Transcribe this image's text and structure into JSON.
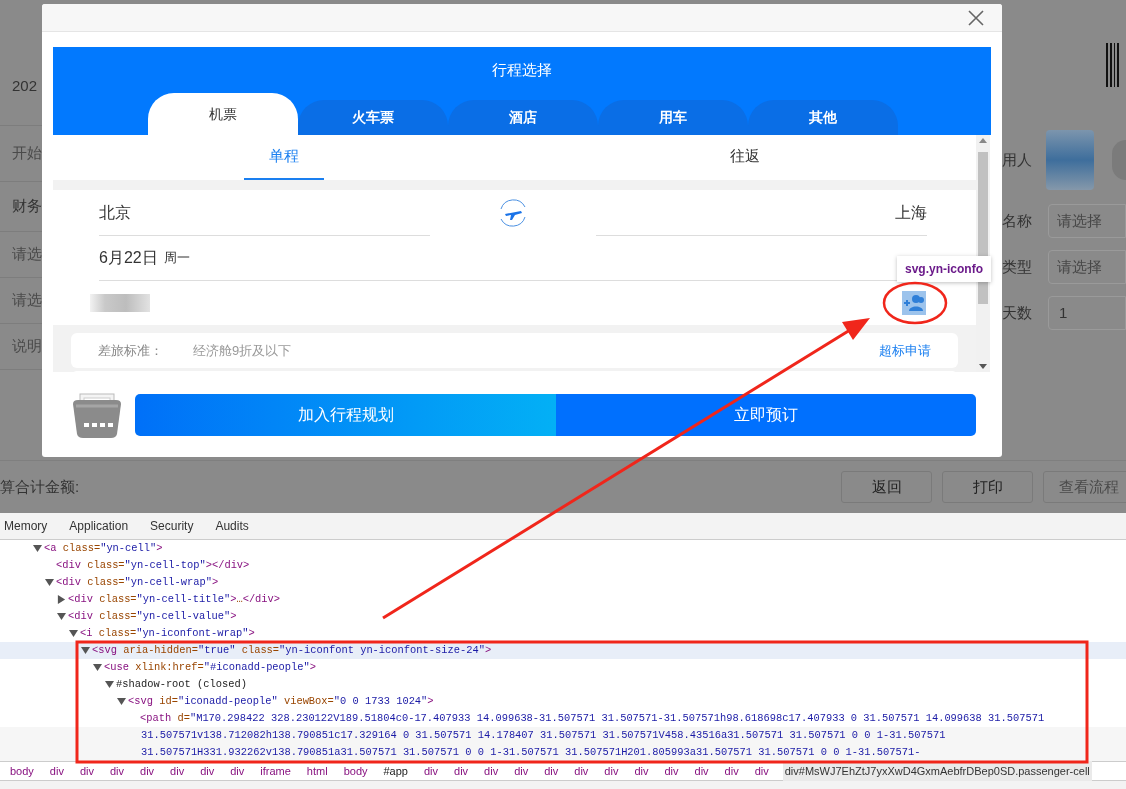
{
  "background_page": {
    "left_items": [
      {
        "kind": "label",
        "text": "202"
      },
      {
        "kind": "placeholder",
        "text": "开始"
      },
      {
        "kind": "label",
        "text": "财务"
      },
      {
        "kind": "placeholder",
        "text": "请选"
      },
      {
        "kind": "placeholder",
        "text": "请选"
      },
      {
        "kind": "placeholder",
        "text": "说明"
      }
    ],
    "right_fields": [
      {
        "kind": "avatar",
        "label": "用人"
      },
      {
        "kind": "select",
        "label": "名称",
        "placeholder": "请选择"
      },
      {
        "kind": "select",
        "label": "类型",
        "placeholder": "请选择"
      },
      {
        "kind": "text",
        "label": "天数",
        "value": "1"
      }
    ],
    "total_label": "算合计金额:",
    "buttons": [
      {
        "label": "返回",
        "disabled": false
      },
      {
        "label": "打印",
        "disabled": false
      },
      {
        "label": "查看流程",
        "disabled": true
      }
    ]
  },
  "dialog": {
    "title": "行程选择",
    "tabs": [
      {
        "label": "机票",
        "selected": true
      },
      {
        "label": "火车票",
        "selected": false
      },
      {
        "label": "酒店",
        "selected": false
      },
      {
        "label": "用车",
        "selected": false
      },
      {
        "label": "其他",
        "selected": false
      }
    ],
    "trip_types": [
      {
        "label": "单程",
        "selected": true
      },
      {
        "label": "往返",
        "selected": false
      }
    ],
    "from": "北京",
    "to": "上海",
    "date": "6月22日",
    "weekday": "周一",
    "tooltip": "svg.yn-iconfo",
    "policy": {
      "label": "差旅标准：",
      "value": "经济舱9折及以下",
      "link": "超标申请"
    },
    "add_plan_button": "加入行程规划",
    "book_button": "立即预订"
  },
  "devtools": {
    "tabs": [
      {
        "label": "Memory",
        "selected": false
      },
      {
        "label": "Application",
        "selected": false
      },
      {
        "label": "Security",
        "selected": false
      },
      {
        "label": "Audits",
        "selected": false
      }
    ],
    "tree": [
      {
        "text": "<a class=\"yn-cell\">",
        "expanded": true,
        "selected": false,
        "children": [
          {
            "text": "<div class=\"yn-cell-top\"></div>",
            "selected": false
          },
          {
            "text": "<div class=\"yn-cell-wrap\">",
            "expanded": true,
            "selected": false,
            "children": [
              {
                "text": "<div class=\"yn-cell-title\">…</div>",
                "expanded": false,
                "selected": false
              },
              {
                "text": "<div class=\"yn-cell-value\">",
                "expanded": true,
                "selected": false,
                "children": [
                  {
                    "text": "<i class=\"yn-iconfont-wrap\">",
                    "expanded": true,
                    "selected": false,
                    "children": [
                      {
                        "text": "<svg aria-hidden=\"true\" class=\"yn-iconfont yn-iconfont-size-24\">",
                        "expanded": true,
                        "selected": true,
                        "children": [
                          {
                            "text": "<use xlink:href=\"#iconadd-people\">",
                            "expanded": true,
                            "selected": false,
                            "children": [
                              {
                                "text": "#shadow-root (closed)",
                                "expanded": true,
                                "selected": false,
                                "children": [
                                  {
                                    "text": "<svg id=\"iconadd-people\" viewBox=\"0 0 1733 1024\">",
                                    "expanded": true,
                                    "selected": false,
                                    "children": [
                                      {
                                        "text": "<path d=\"M170.298422 328.230122V189.51804c0-17.407933 14.099638-31.507571 31.507571-31.507571h98.618698c17.407933 0 31.507571 14.099638 31.507571",
                                        "continuation": [
                                          "31.507571v138.712082h138.790851c17.329164 0 31.507571 14.178407 31.507571 31.507571V458.43516a31.507571 31.507571 0 0 1-31.507571",
                                          "31.507571H331.932262v138.790851a31.507571 31.507571 0 0 1-31.507571 31.507571H201.805993a31.507571 31.507571 0 0 1-31.507571-"
                                        ],
                                        "selected": false
                                      }
                                    ]
                                  }
                                ]
                              }
                            ]
                          }
                        ]
                      }
                    ]
                  }
                ]
              }
            ]
          }
        ]
      }
    ],
    "breadcrumbs": [
      {
        "label": "body",
        "kind": "tag",
        "selected": false
      },
      {
        "label": "div",
        "kind": "tag",
        "selected": false
      },
      {
        "label": "div",
        "kind": "tag",
        "selected": false
      },
      {
        "label": "div",
        "kind": "tag",
        "selected": false
      },
      {
        "label": "div",
        "kind": "tag",
        "selected": false
      },
      {
        "label": "div",
        "kind": "tag",
        "selected": false
      },
      {
        "label": "div",
        "kind": "tag",
        "selected": false
      },
      {
        "label": "div",
        "kind": "tag",
        "selected": false
      },
      {
        "label": "iframe",
        "kind": "tag",
        "selected": false
      },
      {
        "label": "html",
        "kind": "tag",
        "selected": false
      },
      {
        "label": "body",
        "kind": "tag",
        "selected": false
      },
      {
        "label": "#app",
        "kind": "id",
        "selected": false
      },
      {
        "label": "div",
        "kind": "tag",
        "selected": false
      },
      {
        "label": "div",
        "kind": "tag",
        "selected": false
      },
      {
        "label": "div",
        "kind": "tag",
        "selected": false
      },
      {
        "label": "div",
        "kind": "tag",
        "selected": false
      },
      {
        "label": "div",
        "kind": "tag",
        "selected": false
      },
      {
        "label": "div",
        "kind": "tag",
        "selected": false
      },
      {
        "label": "div",
        "kind": "tag",
        "selected": false
      },
      {
        "label": "div",
        "kind": "tag",
        "selected": false
      },
      {
        "label": "div",
        "kind": "tag",
        "selected": false
      },
      {
        "label": "div",
        "kind": "tag",
        "selected": false
      },
      {
        "label": "div",
        "kind": "tag",
        "selected": false
      },
      {
        "label": "div",
        "kind": "tag",
        "selected": false
      },
      {
        "label": "div#MsWJ7EhZtJ7yxXwD4GxmAebfrDBep0SD.passenger-cell",
        "kind": "selector",
        "selected": true
      }
    ]
  }
}
